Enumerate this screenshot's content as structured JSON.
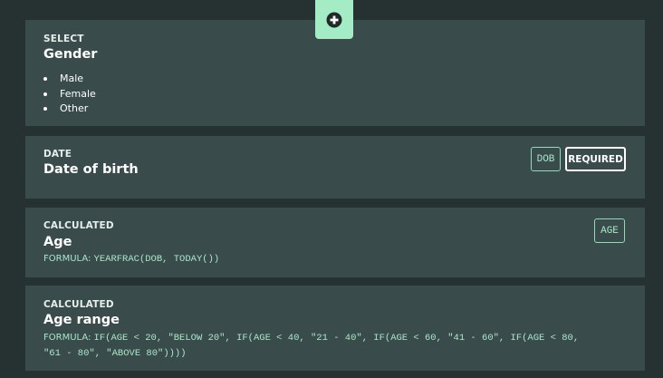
{
  "toolbar": {
    "add_icon": "plus-circle-icon"
  },
  "fields": [
    {
      "type_label": "SELECT",
      "title": "Gender",
      "options": [
        "Male",
        "Female",
        "Other"
      ]
    },
    {
      "type_label": "DATE",
      "title": "Date of birth",
      "badges": {
        "variable": "DOB",
        "required": "REQUIRED"
      }
    },
    {
      "type_label": "CALCULATED",
      "title": "Age",
      "formula_prefix": "FORMULA:",
      "formula": "YEARFRAC(DOB, TODAY())",
      "badges": {
        "variable": "AGE"
      }
    },
    {
      "type_label": "CALCULATED",
      "title": "Age range",
      "formula_prefix": "FORMULA:",
      "formula_line1": "IF(AGE < 20, \"BELOW 20\", IF(AGE < 40, \"21 - 40\", IF(AGE < 60, \"41 - 60\", IF(AGE < 80,",
      "formula_line2": "\"61 - 80\", \"ABOVE 80\"))))"
    }
  ],
  "colors": {
    "background": "#263231",
    "card": "#3a4b4b",
    "accent": "#a3ecc6",
    "formula_text": "#a8e8c8",
    "text": "#ffffff"
  }
}
